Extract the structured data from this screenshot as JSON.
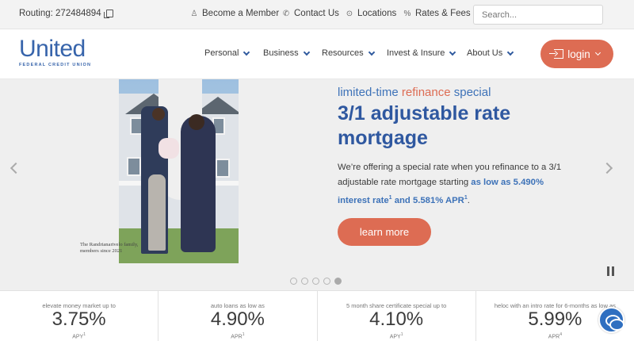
{
  "topbar": {
    "routing_label": "Routing: 272484894",
    "links": [
      {
        "label": "Become a Member",
        "icon": "person-icon"
      },
      {
        "label": "Contact Us",
        "icon": "phone-icon"
      },
      {
        "label": "Locations",
        "icon": "pin-icon"
      },
      {
        "label": "Rates & Fees",
        "icon": "percent-icon"
      }
    ],
    "search_placeholder": "Search..."
  },
  "logo": {
    "name": "United",
    "subtitle": "FEDERAL CREDIT UNION"
  },
  "nav": {
    "items": [
      "Personal",
      "Business",
      "Resources",
      "Invest & Insure",
      "About Us"
    ],
    "login_label": "login"
  },
  "hero": {
    "eyebrow_pre": "limited-time ",
    "eyebrow_accent": "refinance",
    "eyebrow_post": " special",
    "title": "3/1 adjustable rate mortgage",
    "body_pre": "We’re offering a special rate when you refinance to a 3/1 adjustable rate mortgage starting ",
    "body_highlight_1": "as low as 5.490% interest rate",
    "body_sup_1": "1",
    "body_mid": " and ",
    "body_highlight_2": "5.581% APR",
    "body_sup_2": "1",
    "body_post": ".",
    "cta": "learn more",
    "caption": "The Randrianarivelo family, members since 2021",
    "slide_count": 5,
    "active_slide": 5
  },
  "rates": [
    {
      "label": "elevate money market up to",
      "value": "3.75%",
      "unit": "APY",
      "sup": "1"
    },
    {
      "label": "auto loans as low as",
      "value": "4.90%",
      "unit": "APR",
      "sup": "1"
    },
    {
      "label": "5 month share certificate special up to",
      "value": "4.10%",
      "unit": "APY",
      "sup": "1"
    },
    {
      "label": "heloc with an intro rate for 6-months as low as",
      "value": "5.99%",
      "unit": "APR",
      "sup": "4"
    }
  ],
  "colors": {
    "brand_blue": "#2f58a0",
    "accent_coral": "#dd6c53",
    "chat_blue": "#2f6fc0"
  }
}
